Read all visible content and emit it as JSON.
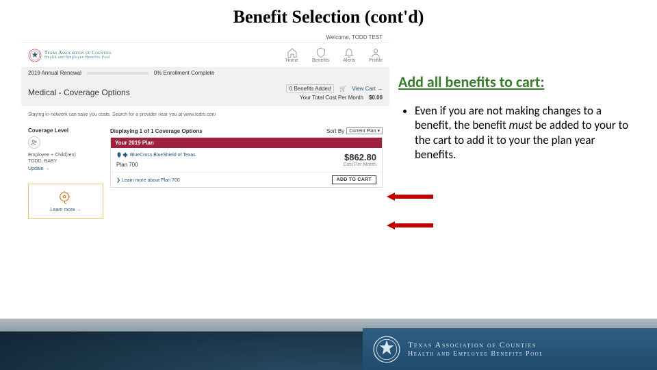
{
  "slide": {
    "title": "Benefit Selection (cont'd)"
  },
  "screenshot": {
    "welcome": "Welcome, TODD TEST",
    "org": {
      "line1": "Texas Association of Counties",
      "line2": "Health and Employee Benefits Pool"
    },
    "nav": {
      "home": "Home",
      "benefits": "Benefits",
      "alerts": "Alerts",
      "profile": "Profile"
    },
    "progress": {
      "label": "2019 Annual Renewal",
      "pct": "0% Enrollment Complete"
    },
    "summary": {
      "title": "Medical - Coverage Options",
      "benefits_added_count": "0",
      "benefits_added_label": "Benefits Added",
      "view_cart": "View Cart →",
      "total_label": "Your Total Cost Per Month",
      "total_value": "$0.00"
    },
    "desc": "Staying in-network can save you costs. Search for a provider near you at www.tcdrs.com",
    "sidebar": {
      "coverage_level_hdr": "Coverage Level",
      "coverage_value": "Employee + Child(ren)",
      "covered_name": "TODD, BABY",
      "update": "Update →",
      "learn_more": "Learn more →"
    },
    "planarea": {
      "displaying": "Displaying 1 of 1 Coverage Options",
      "sortby_label": "Sort By",
      "sortby_value": "Current Plan",
      "plan_header": "Your 2019 Plan",
      "provider": "BlueCross BlueShield of Texas",
      "plan_name": "Plan 700",
      "price": "$862.80",
      "price_label": "Cost Per Month",
      "learn_more": "Learn more about Plan 700",
      "add_to_cart": "ADD TO CART"
    }
  },
  "instructions": {
    "heading": "Add all benefits to cart:",
    "bullet_pre": "Even if you are not making changes to a benefit, the benefit ",
    "bullet_em": "must",
    "bullet_post": " be added to your to the cart to add it to your the plan year benefits."
  },
  "footer": {
    "org_line1": "Texas Association of Counties",
    "org_line2": "Health and Employee Benefits Pool"
  }
}
